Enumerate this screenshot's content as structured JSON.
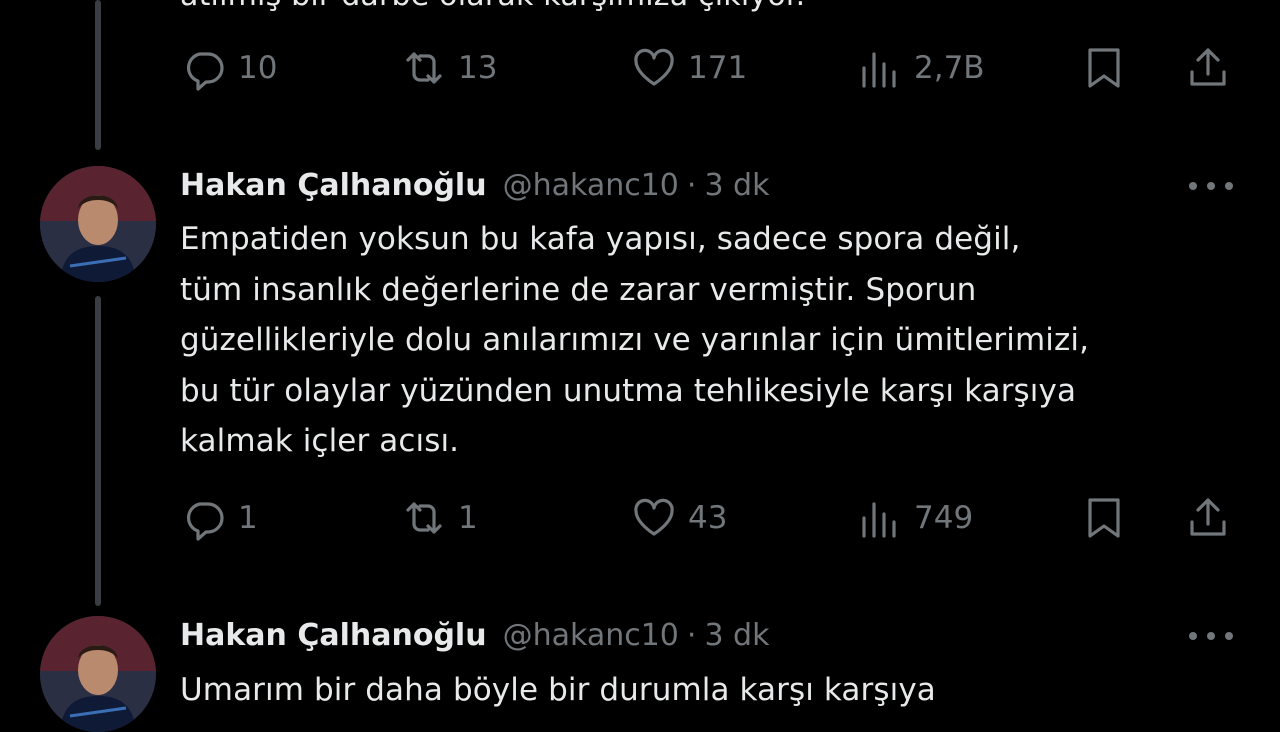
{
  "top_tweet": {
    "partial_text": "atılmış bir darbe olarak karşımıza çıkıyor.",
    "actions": {
      "replies": "10",
      "retweets": "13",
      "likes": "171",
      "views": "2,7B"
    }
  },
  "tweets": [
    {
      "name": "Hakan Çalhanoğlu",
      "handle": "@hakanc10",
      "separator": "·",
      "time": "3 dk",
      "text": "Empatiden yoksun bu kafa yapısı, sadece spora değil,\ntüm insanlık değerlerine de zarar vermiştir.  Sporun\ngüzellikleriyle dolu anılarımızı ve yarınlar için ümitlerimizi,\nbu tür olaylar yüzünden unutma tehlikesiyle karşı karşıya\nkalmak içler acısı.",
      "actions": {
        "replies": "1",
        "retweets": "1",
        "likes": "43",
        "views": "749"
      }
    },
    {
      "name": "Hakan Çalhanoğlu",
      "handle": "@hakanc10",
      "separator": "·",
      "time": "3 dk",
      "text": "Umarım bir daha böyle bir durumla karşı karşıya"
    }
  ],
  "icons": {
    "reply": "reply-icon",
    "retweet": "retweet-icon",
    "like": "heart-icon",
    "views": "views-icon",
    "bookmark": "bookmark-icon",
    "share": "share-icon",
    "more": "more-icon"
  },
  "colors": {
    "background": "#000000",
    "text": "#e7e9ea",
    "muted": "#71767b",
    "thread_line": "#3a3d41"
  }
}
